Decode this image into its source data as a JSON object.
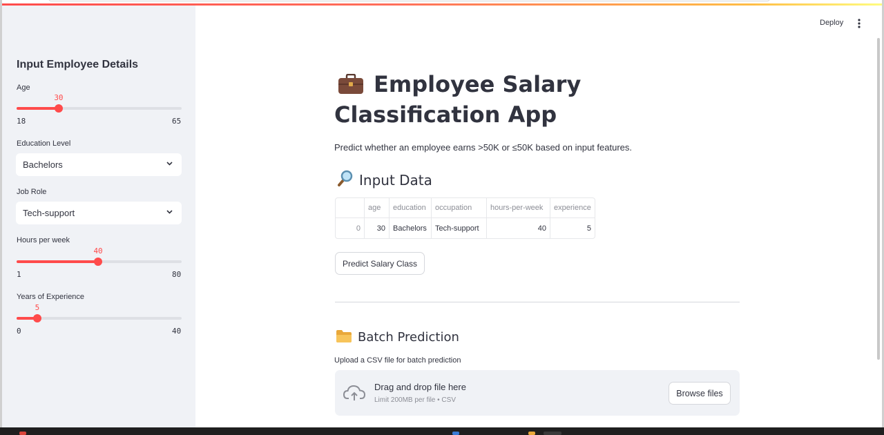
{
  "sidebar": {
    "title": "Input Employee Details",
    "age": {
      "label": "Age",
      "value": "30",
      "min": "18",
      "max": "65",
      "level": 0.255
    },
    "education": {
      "label": "Education Level",
      "selected": "Bachelors"
    },
    "job_role": {
      "label": "Job Role",
      "selected": "Tech-support"
    },
    "hours": {
      "label": "Hours per week",
      "value": "40",
      "min": "1",
      "max": "80",
      "level": 0.494
    },
    "experience": {
      "label": "Years of Experience",
      "value": "5",
      "min": "0",
      "max": "40",
      "level": 0.125
    }
  },
  "header": {
    "deploy_label": "Deploy",
    "menu_icon": "kebab-menu-icon"
  },
  "main": {
    "title": "Employee Salary Classification App",
    "title_icon": "briefcase-icon",
    "subtitle": "Predict whether an employee earns >50K or ≤50K based on input features.",
    "input_heading": "Input Data",
    "input_icon": "magnifier-icon",
    "table": {
      "columns": [
        "",
        "age",
        "education",
        "occupation",
        "hours-per-week",
        "experience"
      ],
      "rows": [
        [
          "0",
          "30",
          "Bachelors",
          "Tech-support",
          "40",
          "5"
        ]
      ]
    },
    "predict_button": "Predict Salary Class",
    "batch_heading": "Batch Prediction",
    "batch_icon": "folder-icon",
    "upload_label": "Upload a CSV file for batch prediction",
    "dropzone": {
      "main": "Drag and drop file here",
      "sub": "Limit 200MB per file • CSV",
      "icon": "cloud-upload-icon",
      "browse_button": "Browse files"
    }
  },
  "colors": {
    "accent": "#ff4b4b",
    "sidebar_bg": "#f0f2f6",
    "text": "#31333f"
  }
}
